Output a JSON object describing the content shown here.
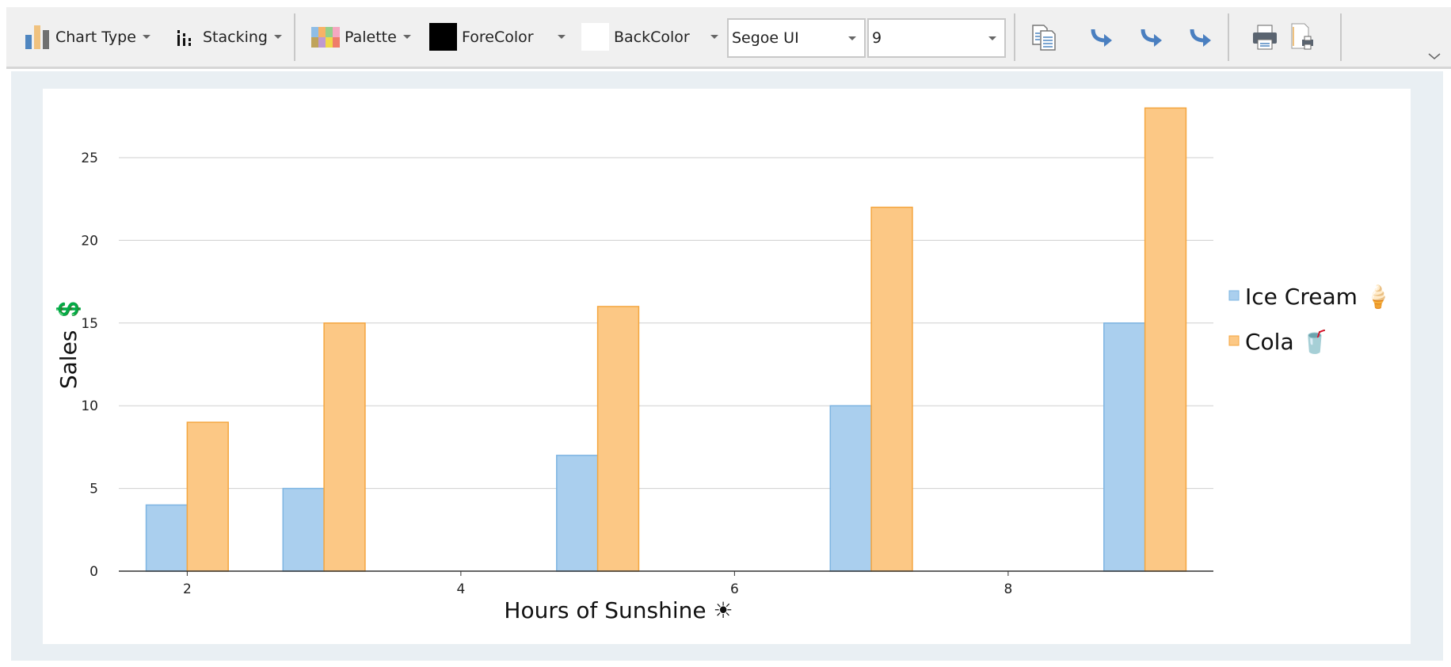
{
  "toolbar": {
    "chart_type": "Chart Type",
    "stacking": "Stacking",
    "palette": "Palette",
    "forecolor": "ForeColor",
    "forecolor_value": "#000000",
    "backcolor": "BackColor",
    "backcolor_value": "#ffffff",
    "font_family": "Segoe UI",
    "font_size": "9",
    "icons": [
      "bar-chart-icon",
      "stacking-icon",
      "palette-icon",
      "copy-icon",
      "export-arrow-icon",
      "export-arrow-icon",
      "export-arrow-icon",
      "print-icon",
      "print-preview-icon",
      "chevron-down-icon"
    ]
  },
  "chart_data": {
    "type": "bar",
    "x": [
      2,
      3,
      5,
      7,
      9
    ],
    "series": [
      {
        "name": "Ice Cream 🍦",
        "values": [
          4,
          5,
          7,
          10,
          15
        ],
        "color": "#aacfee",
        "stroke": "#7db4e2"
      },
      {
        "name": "Cola 🥤",
        "values": [
          9,
          15,
          16,
          22,
          28
        ],
        "color": "#fcc885",
        "stroke": "#f4a640"
      }
    ],
    "xlabel": "Hours of Sunshine ☀",
    "ylabel": "Sales 💲",
    "xticks": [
      2,
      4,
      6,
      8
    ],
    "yticks": [
      0,
      5,
      10,
      15,
      20,
      25
    ],
    "xlim": [
      1.5,
      9.5
    ],
    "ylim": [
      0,
      28
    ],
    "grid": "horizontal",
    "legend": "right"
  }
}
